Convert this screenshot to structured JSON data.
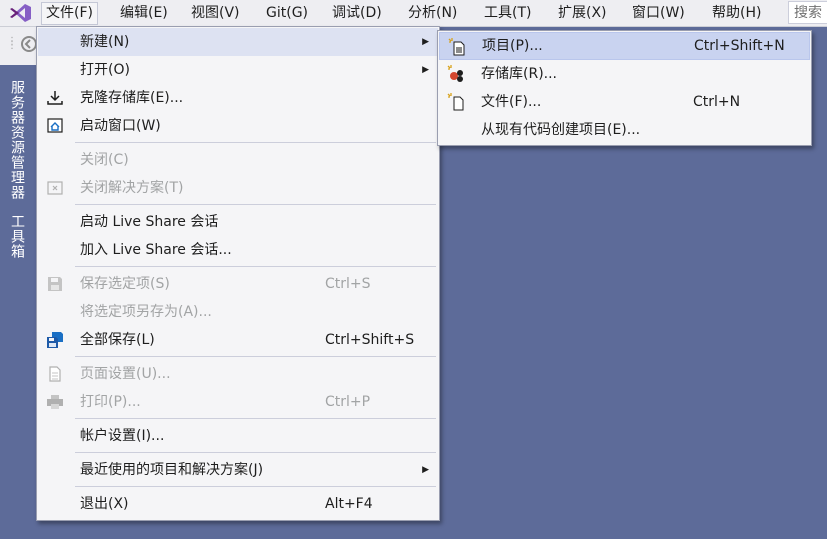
{
  "menubar": {
    "items": [
      {
        "label": "文件(F)"
      },
      {
        "label": "编辑(E)"
      },
      {
        "label": "视图(V)"
      },
      {
        "label": "Git(G)"
      },
      {
        "label": "调试(D)"
      },
      {
        "label": "分析(N)"
      },
      {
        "label": "工具(T)"
      },
      {
        "label": "扩展(X)"
      },
      {
        "label": "窗口(W)"
      },
      {
        "label": "帮助(H)"
      }
    ],
    "search_label": "搜索"
  },
  "sidetabs": [
    "服务器资源管理器",
    "工具箱"
  ],
  "file_menu": {
    "items": [
      {
        "label": "新建(N)",
        "shortcut": "",
        "icon": "none",
        "disabled": false,
        "submenu": true
      },
      {
        "label": "打开(O)",
        "shortcut": "",
        "icon": "none",
        "disabled": false,
        "submenu": true
      },
      {
        "label": "克隆存储库(E)...",
        "shortcut": "",
        "icon": "clone-repo-icon",
        "disabled": false,
        "submenu": false
      },
      {
        "label": "启动窗口(W)",
        "shortcut": "",
        "icon": "start-window-icon",
        "disabled": false,
        "submenu": false
      },
      {
        "label": "关闭(C)",
        "shortcut": "",
        "icon": "none",
        "disabled": true,
        "submenu": false
      },
      {
        "label": "关闭解决方案(T)",
        "shortcut": "",
        "icon": "close-solution-icon",
        "disabled": true,
        "submenu": false
      },
      {
        "label": "启动 Live Share 会话",
        "shortcut": "",
        "icon": "none",
        "disabled": false,
        "submenu": false
      },
      {
        "label": "加入 Live Share 会话...",
        "shortcut": "",
        "icon": "none",
        "disabled": false,
        "submenu": false
      },
      {
        "label": "保存选定项(S)",
        "shortcut": "Ctrl+S",
        "icon": "save-icon",
        "disabled": true,
        "submenu": false
      },
      {
        "label": "将选定项另存为(A)...",
        "shortcut": "",
        "icon": "none",
        "disabled": true,
        "submenu": false
      },
      {
        "label": "全部保存(L)",
        "shortcut": "Ctrl+Shift+S",
        "icon": "save-all-icon",
        "disabled": false,
        "submenu": false
      },
      {
        "label": "页面设置(U)...",
        "shortcut": "",
        "icon": "page-setup-icon",
        "disabled": true,
        "submenu": false
      },
      {
        "label": "打印(P)...",
        "shortcut": "Ctrl+P",
        "icon": "print-icon",
        "disabled": true,
        "submenu": false
      },
      {
        "label": "帐户设置(I)...",
        "shortcut": "",
        "icon": "none",
        "disabled": false,
        "submenu": false
      },
      {
        "label": "最近使用的项目和解决方案(J)",
        "shortcut": "",
        "icon": "none",
        "disabled": false,
        "submenu": true
      },
      {
        "label": "退出(X)",
        "shortcut": "Alt+F4",
        "icon": "none",
        "disabled": false,
        "submenu": false
      }
    ]
  },
  "new_submenu": {
    "items": [
      {
        "label": "项目(P)...",
        "shortcut": "Ctrl+Shift+N",
        "icon": "new-project-icon"
      },
      {
        "label": "存储库(R)...",
        "shortcut": "",
        "icon": "repository-icon"
      },
      {
        "label": "文件(F)...",
        "shortcut": "Ctrl+N",
        "icon": "new-file-icon"
      },
      {
        "label": "从现有代码创建项目(E)...",
        "shortcut": "",
        "icon": "none"
      }
    ]
  },
  "colors": {
    "background": "#5d6b99",
    "menu_background": "#f5f5f7",
    "hover": "#dde2f2",
    "submenu_hover": "#c9d3f0",
    "disabled_text": "#a2a4a5",
    "vs_purple": "#68217a"
  }
}
